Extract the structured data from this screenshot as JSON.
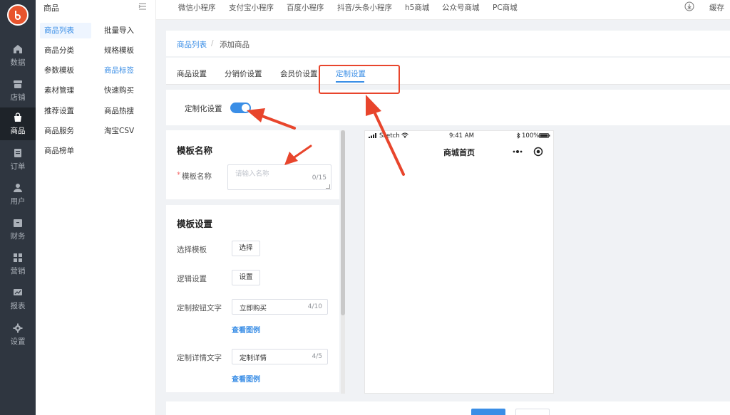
{
  "sidebar": {
    "logo_icon": "app-logo",
    "items": [
      {
        "label": "数据",
        "icon": "home-icon"
      },
      {
        "label": "店铺",
        "icon": "store-icon"
      },
      {
        "label": "商品",
        "icon": "bag-icon",
        "active": true
      },
      {
        "label": "订单",
        "icon": "order-icon"
      },
      {
        "label": "用户",
        "icon": "user-icon"
      },
      {
        "label": "财务",
        "icon": "wallet-icon"
      },
      {
        "label": "营销",
        "icon": "grid-icon"
      },
      {
        "label": "报表",
        "icon": "chart-icon"
      },
      {
        "label": "设置",
        "icon": "gear-icon"
      }
    ]
  },
  "submenu": {
    "title": "商品",
    "col1": [
      "商品列表",
      "商品分类",
      "参数模板",
      "素材管理",
      "推荐设置",
      "商品服务",
      "商品榜单"
    ],
    "col2": [
      "批量导入",
      "规格模板",
      "商品标签",
      "快速购买",
      "商品热搜",
      "淘宝CSV"
    ]
  },
  "topbar": {
    "tabs": [
      "微信小程序",
      "支付宝小程序",
      "百度小程序",
      "抖音/头条小程序",
      "h5商城",
      "公众号商城",
      "PC商城"
    ],
    "cache_label": "缓存"
  },
  "breadcrumb": {
    "link": "商品列表",
    "separator": "/",
    "current": "添加商品"
  },
  "tabs": [
    "商品设置",
    "分销价设置",
    "会员价设置",
    "定制设置"
  ],
  "customize": {
    "toggle_label": "定制化设置",
    "enabled": true
  },
  "template_name": {
    "title": "模板名称",
    "required_mark": "*",
    "label": "模板名称",
    "placeholder": "请输入名称",
    "counter": "0/15"
  },
  "template_settings": {
    "title": "模板设置",
    "select_template_label": "选择模板",
    "select_button": "选择",
    "logic_label": "逻辑设置",
    "logic_button": "设置",
    "button_text_label": "定制按钮文字",
    "button_text_value": "立即购买",
    "button_text_counter": "4/10",
    "detail_text_label": "定制详情文字",
    "detail_text_value": "定制详情",
    "detail_text_counter": "4/5",
    "view_example": "查看图例"
  },
  "phone_preview": {
    "carrier": "Sketch",
    "time": "9:41 AM",
    "battery": "100%",
    "title": "商城首页"
  },
  "colors": {
    "accent": "#3a8ee6",
    "rail": "#2f3640",
    "annotation": "#e8452c",
    "logo": "#e8542d"
  }
}
